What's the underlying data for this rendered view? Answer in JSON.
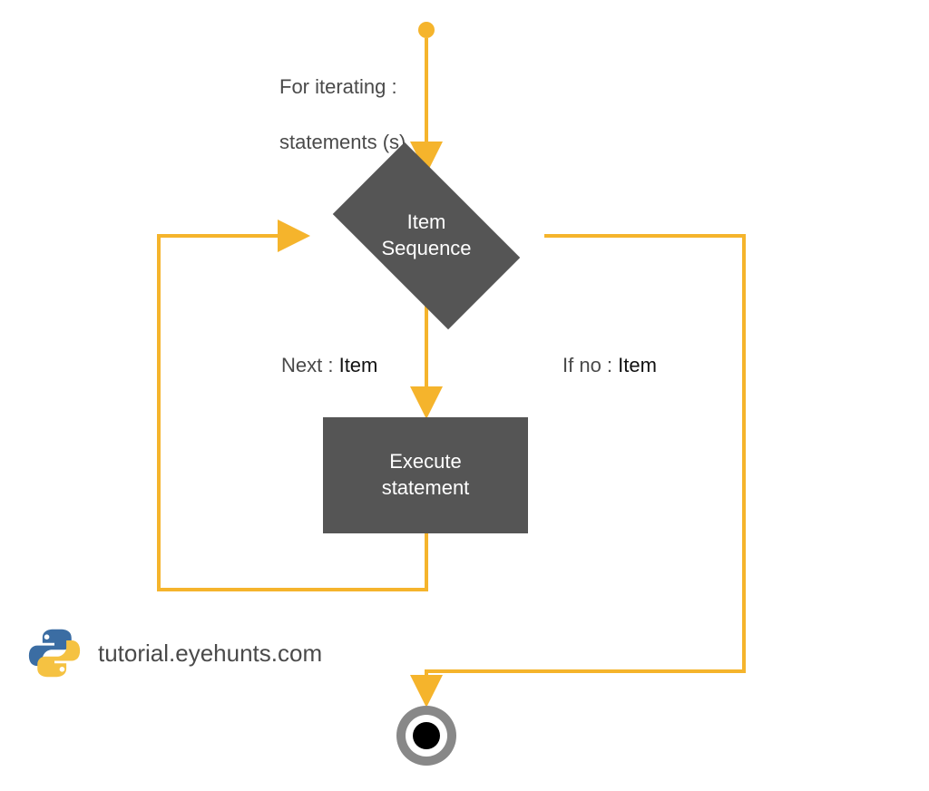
{
  "colors": {
    "accent": "#f5b42c",
    "box": "#555555",
    "text_dim": "#4a4a4a",
    "text_dark": "#111111"
  },
  "start": {
    "present": true
  },
  "title": {
    "line1": "For iterating :",
    "line2": "statements (s)"
  },
  "decision": {
    "line1": "Item",
    "line2": "Sequence"
  },
  "edge_labels": {
    "next_prefix": "Next : ",
    "next_bold": "Item",
    "ifno_prefix": "If no : ",
    "ifno_bold": "Item"
  },
  "process": {
    "line1": "Execute",
    "line2": "statement"
  },
  "end": {
    "present": true
  },
  "watermark": {
    "text": "tutorial.eyehunts.com",
    "logo": "python-icon"
  }
}
